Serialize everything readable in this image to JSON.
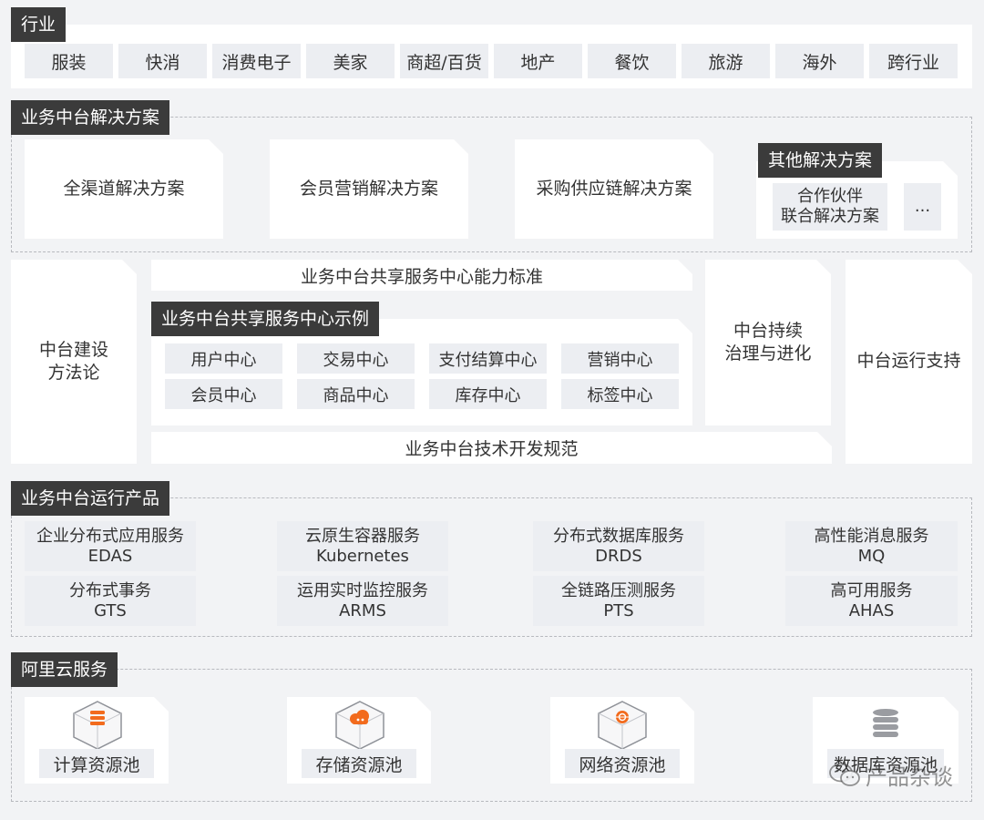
{
  "industry": {
    "tag": "行业",
    "items": [
      "服装",
      "快消",
      "消费电子",
      "美家",
      "商超/百货",
      "地产",
      "餐饮",
      "旅游",
      "海外",
      "跨行业"
    ]
  },
  "solutions": {
    "tag": "业务中台解决方案",
    "cards": [
      "全渠道解决方案",
      "会员营销解决方案",
      "采购供应链解决方案"
    ],
    "other": {
      "tag": "其他解决方案",
      "partner_line1": "合作伙伴",
      "partner_line2": "联合解决方案",
      "more": "..."
    }
  },
  "middle": {
    "methodology_line1": "中台建设",
    "methodology_line2": "方法论",
    "standard": "业务中台共享服务中心能力标准",
    "examples_tag": "业务中台共享服务中心示例",
    "centers": [
      "用户中心",
      "交易中心",
      "支付结算中心",
      "营销中心",
      "会员中心",
      "商品中心",
      "库存中心",
      "标签中心"
    ],
    "tech_spec": "业务中台技术开发规范",
    "governance_line1": "中台持续",
    "governance_line2": "治理与进化",
    "ops_support": "中台运行支持"
  },
  "products": {
    "tag": "业务中台运行产品",
    "items": [
      {
        "name": "企业分布式应用服务",
        "code": "EDAS"
      },
      {
        "name": "云原生容器服务",
        "code": "Kubernetes"
      },
      {
        "name": "分布式数据库服务",
        "code": "DRDS"
      },
      {
        "name": "高性能消息服务",
        "code": "MQ"
      },
      {
        "name": "分布式事务",
        "code": "GTS"
      },
      {
        "name": "运用实时监控服务",
        "code": "ARMS"
      },
      {
        "name": "全链路压测服务",
        "code": "PTS"
      },
      {
        "name": "高可用服务",
        "code": "AHAS"
      }
    ]
  },
  "cloud": {
    "tag": "阿里云服务",
    "pools": [
      {
        "label": "计算资源池",
        "icon": "compute-icon"
      },
      {
        "label": "存储资源池",
        "icon": "storage-icon"
      },
      {
        "label": "网络资源池",
        "icon": "network-icon"
      },
      {
        "label": "数据库资源池",
        "icon": "database-icon"
      }
    ]
  },
  "watermark": "产品杂谈",
  "colors": {
    "tag_bg": "#3b3b3b",
    "accent_orange": "#f26b1d",
    "pill_bg": "#eceef2",
    "background": "#f2f3f5"
  }
}
